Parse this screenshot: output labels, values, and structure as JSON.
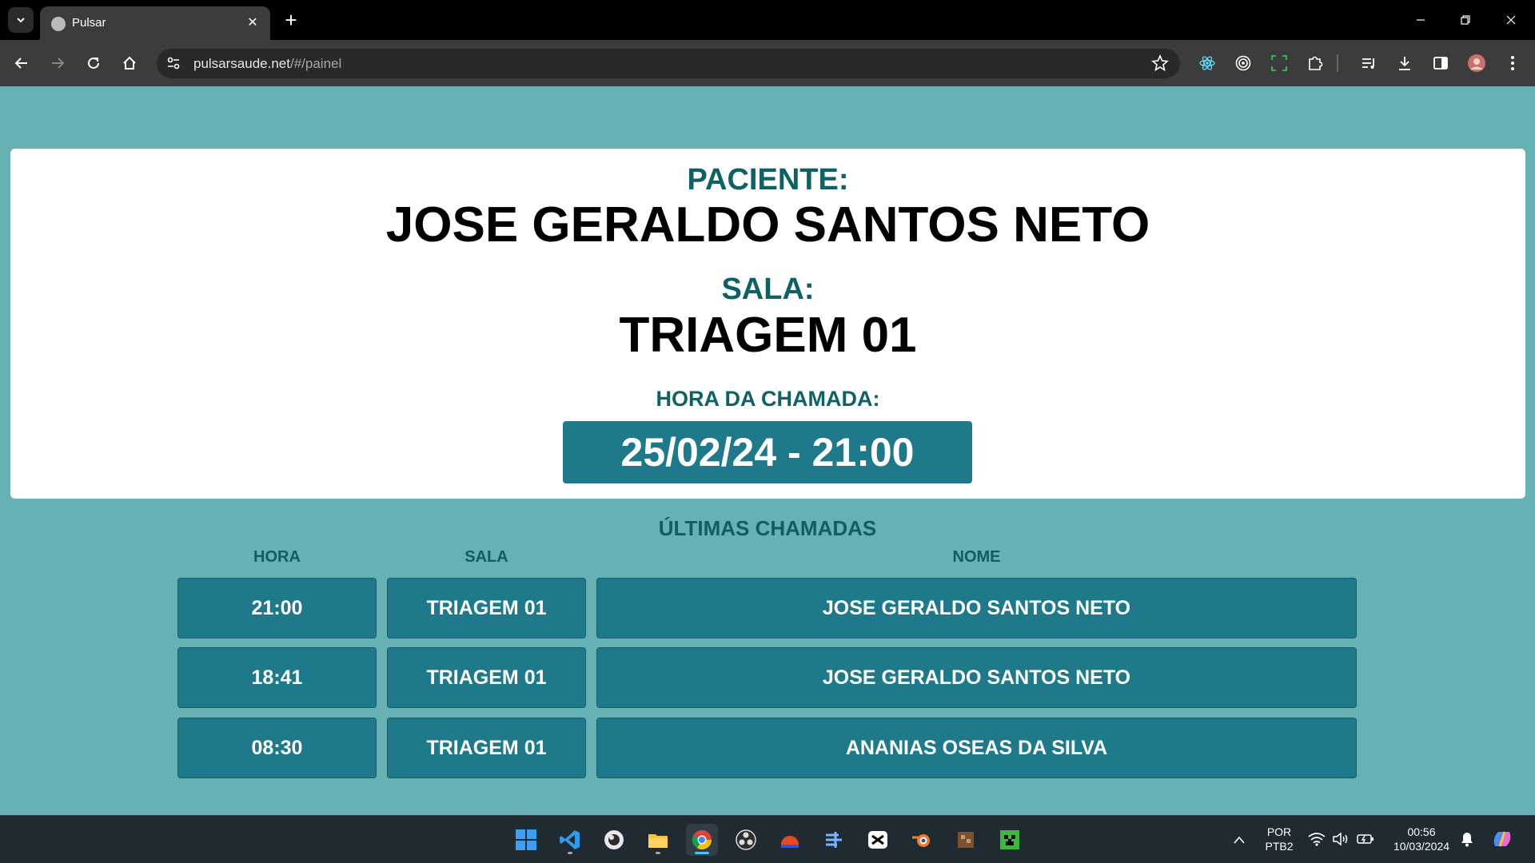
{
  "browser": {
    "tab_title": "Pulsar",
    "url_host": "pulsarsaude.net",
    "url_path": "/#/painel"
  },
  "panel": {
    "paciente_label": "PACIENTE:",
    "paciente_name": "JOSE GERALDO SANTOS NETO",
    "sala_label": "SALA:",
    "sala_value": "TRIAGEM 01",
    "hora_label": "HORA DA CHAMADA:",
    "hora_value": "25/02/24 - 21:00"
  },
  "history": {
    "title": "ÚLTIMAS CHAMADAS",
    "headers": {
      "hora": "HORA",
      "sala": "SALA",
      "nome": "NOME"
    },
    "rows": [
      {
        "hora": "21:00",
        "sala": "TRIAGEM 01",
        "nome": "JOSE GERALDO SANTOS NETO"
      },
      {
        "hora": "18:41",
        "sala": "TRIAGEM 01",
        "nome": "JOSE GERALDO SANTOS NETO"
      },
      {
        "hora": "08:30",
        "sala": "TRIAGEM 01",
        "nome": "ANANIAS OSEAS DA SILVA"
      }
    ]
  },
  "taskbar": {
    "lang_line1": "POR",
    "lang_line2": "PTB2",
    "time": "00:56",
    "date": "10/03/2024"
  },
  "colors": {
    "page_bg": "#66b1b3",
    "accent_box": "#1e7a8a",
    "label_teal": "#0e6266"
  }
}
